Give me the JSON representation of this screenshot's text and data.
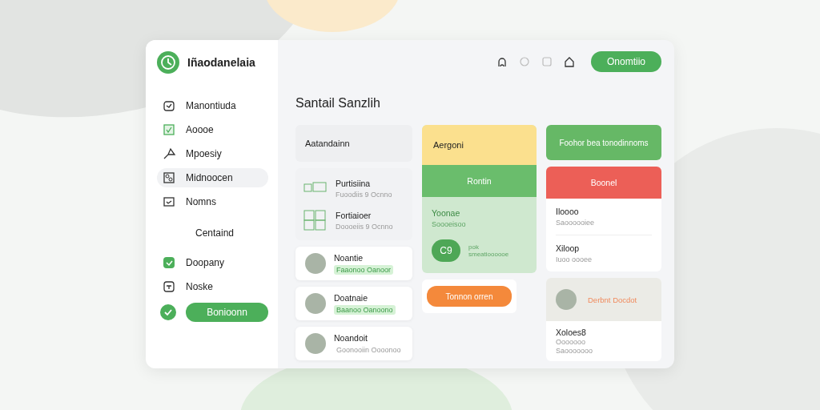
{
  "app": {
    "name": "Iñaodanelaia"
  },
  "sidebar": {
    "items": [
      {
        "kind": "item",
        "label": "Manontiuda",
        "selected": false
      },
      {
        "kind": "item",
        "label": "Aoooe",
        "selected": false
      },
      {
        "kind": "item",
        "label": "Mpoesiy",
        "selected": false
      },
      {
        "kind": "item",
        "label": "Midnoocen",
        "selected": true
      },
      {
        "kind": "item",
        "label": "Nomns",
        "selected": false
      },
      {
        "kind": "section",
        "label": "Centaind"
      },
      {
        "kind": "item",
        "label": "Doopany",
        "selected": false
      },
      {
        "kind": "item",
        "label": "Noske",
        "selected": false
      }
    ],
    "button": "Bonioonn"
  },
  "toolbar": {
    "button": "Onomtiio"
  },
  "page_title": "Santail Sanzlih",
  "column_1": {
    "header": "Aatandainn",
    "list": [
      {
        "title": "Purtisiina",
        "subtitle": "Fuoodiis 9 Ocnno"
      },
      {
        "title": "Fortiaioer",
        "subtitle": "Doooeiis 9 Ocnno"
      }
    ],
    "people": [
      {
        "name": "Noantie",
        "tag": "Faaonoo Oanoor",
        "highlighted": true
      },
      {
        "name": "Doatnaie",
        "tag": "Baanoo Oanoono",
        "highlighted": true
      },
      {
        "name": "Noandoit",
        "tag": "Goonooiin Oooonoo",
        "highlighted": false
      }
    ]
  },
  "column_2": {
    "header": "Aergoni",
    "band": "Rontin",
    "title": "Yoonae",
    "subtitle": "Soooeisoo",
    "badge": "C9",
    "badge_title": "pok",
    "badge_subtitle": "smeatioooooe",
    "button": "Tonnon orren"
  },
  "column_3": {
    "button": "Foohor bea tonodinnoms",
    "alert": "Boonel",
    "rows": [
      {
        "title": "Iloooo",
        "subtitle": "Saoooooiee"
      },
      {
        "title": "Xiloop",
        "subtitle": "Iuoo oooee"
      }
    ],
    "profile": {
      "name": "Derbnt Docdot",
      "title": "Xoloes8",
      "lines": [
        "Ooooooo",
        "Saooooooo"
      ]
    }
  }
}
